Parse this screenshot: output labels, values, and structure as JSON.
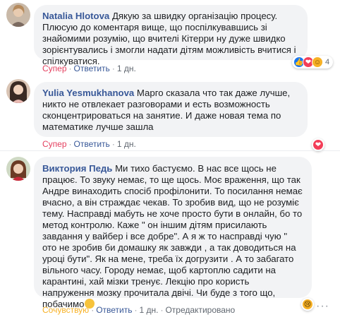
{
  "comments": [
    {
      "author": "Natalia Hlotova",
      "text": "Дякую за швидку організацію процесу. Плюсую до коментаря вище, що поспілкувавшись зі знайомими розумію, що вчителі Кітерри ну дуже швидко зорієнтувались і змогли надати дітям можливість вчитися і спілкуватися.",
      "reaction_label": "Супер",
      "reply_label": "Ответить",
      "time": "1 дн.",
      "reaction_count": "4",
      "reaction_icons": [
        "like-reaction-icon",
        "love-reaction-icon",
        "care-reaction-icon"
      ],
      "colors": {
        "reaction": "#e4405f"
      }
    },
    {
      "author": "Yulia Yesmukhanova",
      "text": "Марго сказала что так даже лучше, никто не отвлекает разговорами и есть возможность сконцентрироваться на занятие. И даже новая тема по математике лучше зашла",
      "reaction_label": "Супер",
      "reply_label": "Ответить",
      "time": "1 дн.",
      "reaction_icons": [
        "love-reaction-icon"
      ],
      "colors": {
        "reaction": "#e4405f"
      }
    },
    {
      "author": "Виктория Педь",
      "text": "Ми тихо бастуємо. В нас все щось не працює. То звуку немає, то ще щось. Моє враження, що так Андре винаходить спосіб профілонити. То посилання немає вчасно, а він страждає чекав. То зробив вид, що не розуміє тему. Насправді мабуть не хоче просто бути в онлайн, бо то метод контролю. Каже \" он іншим дітям присилають завдання у вайбер і все добре\". А я ж то насправді чую \" ото не зробив би домашку як завжди , а так доводиться на уроці бути\". Як на мене, треба їх догрузити . А то забагато вільного часу. Городу немає, щоб картоплю садити на карантині, хай мізки тренує. Лекцію про користь напруження мозку прочитала двічі. Чи буде з того що, побачимо",
      "reaction_label": "Сочувствую",
      "reply_label": "Ответить",
      "time": "1 дн.",
      "edited": "Отредактировано",
      "reaction_icons": [
        "sad-reaction-icon"
      ],
      "colors": {
        "reaction": "#f7b125"
      }
    }
  ]
}
